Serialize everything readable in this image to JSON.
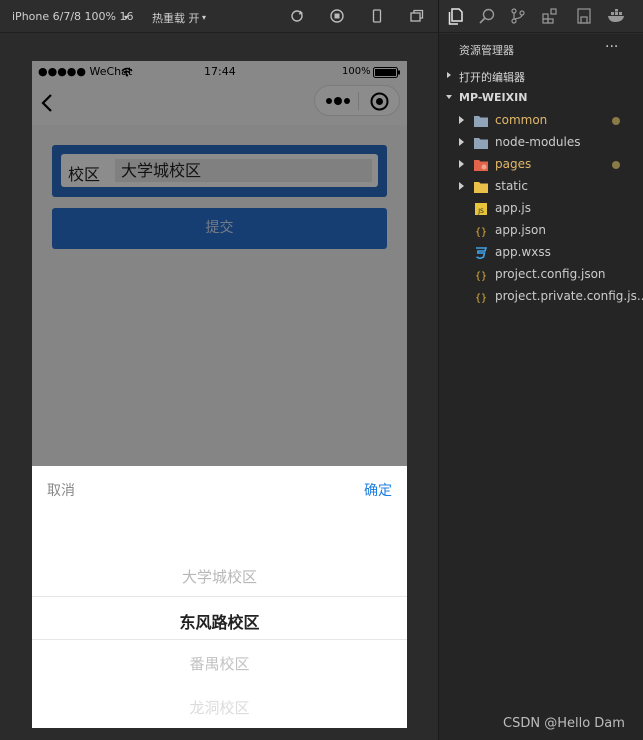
{
  "toolbar": {
    "device_label": "iPhone 6/7/8 100% 16",
    "hot_reload_label": "热重载 开"
  },
  "phone": {
    "status": {
      "carrier": "●●●●● WeChat",
      "time": "17:44",
      "battery": "100%"
    },
    "form": {
      "field_label": "校区",
      "field_value": "大学城校区",
      "submit_label": "提交"
    },
    "picker": {
      "cancel_label": "取消",
      "confirm_label": "确定",
      "options": [
        "大学城校区",
        "东风路校区",
        "番禺校区",
        "龙洞校区"
      ],
      "selected_index": 1
    }
  },
  "explorer": {
    "title": "资源管理器",
    "more": "···",
    "open_editors": "打开的编辑器",
    "project": "MP-WEIXIN",
    "files": [
      {
        "name": "common",
        "type": "folder",
        "color": "#e2b86a",
        "modified": true
      },
      {
        "name": "node-modules",
        "type": "folder",
        "color": "#cccccc",
        "modified": false
      },
      {
        "name": "pages",
        "type": "folder",
        "color": "#e2b86a",
        "modified": true
      },
      {
        "name": "static",
        "type": "folder",
        "color": "#cccccc",
        "modified": false
      },
      {
        "name": "app.js",
        "type": "js",
        "color": "#cccccc",
        "modified": false
      },
      {
        "name": "app.json",
        "type": "json",
        "color": "#cccccc",
        "modified": false
      },
      {
        "name": "app.wxss",
        "type": "wxss",
        "color": "#cccccc",
        "modified": false
      },
      {
        "name": "project.config.json",
        "type": "json",
        "color": "#cccccc",
        "modified": false
      },
      {
        "name": "project.private.config.js...",
        "type": "json",
        "color": "#cccccc",
        "modified": false
      }
    ]
  },
  "watermark": "CSDN @Hello Dam"
}
